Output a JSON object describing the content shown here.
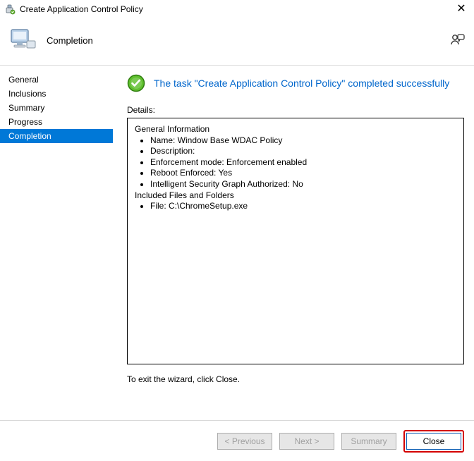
{
  "window": {
    "title": "Create Application Control Policy"
  },
  "header": {
    "page_title": "Completion"
  },
  "sidebar": {
    "items": [
      {
        "label": "General",
        "selected": false
      },
      {
        "label": "Inclusions",
        "selected": false
      },
      {
        "label": "Summary",
        "selected": false
      },
      {
        "label": "Progress",
        "selected": false
      },
      {
        "label": "Completion",
        "selected": true
      }
    ]
  },
  "content": {
    "status_text": "The task \"Create Application Control Policy\" completed successfully",
    "details_label": "Details:",
    "details": {
      "section1_title": "General Information",
      "section1_items": [
        "Name: Window Base WDAC Policy",
        "Description:",
        "Enforcement mode: Enforcement enabled",
        "Reboot Enforced: Yes",
        "Intelligent Security Graph Authorized: No"
      ],
      "section2_title": "Included Files and Folders",
      "section2_items": [
        "File: C:\\ChromeSetup.exe"
      ]
    },
    "exit_hint": "To exit the wizard, click Close."
  },
  "footer": {
    "previous": "< Previous",
    "next": "Next >",
    "summary": "Summary",
    "close": "Close"
  }
}
